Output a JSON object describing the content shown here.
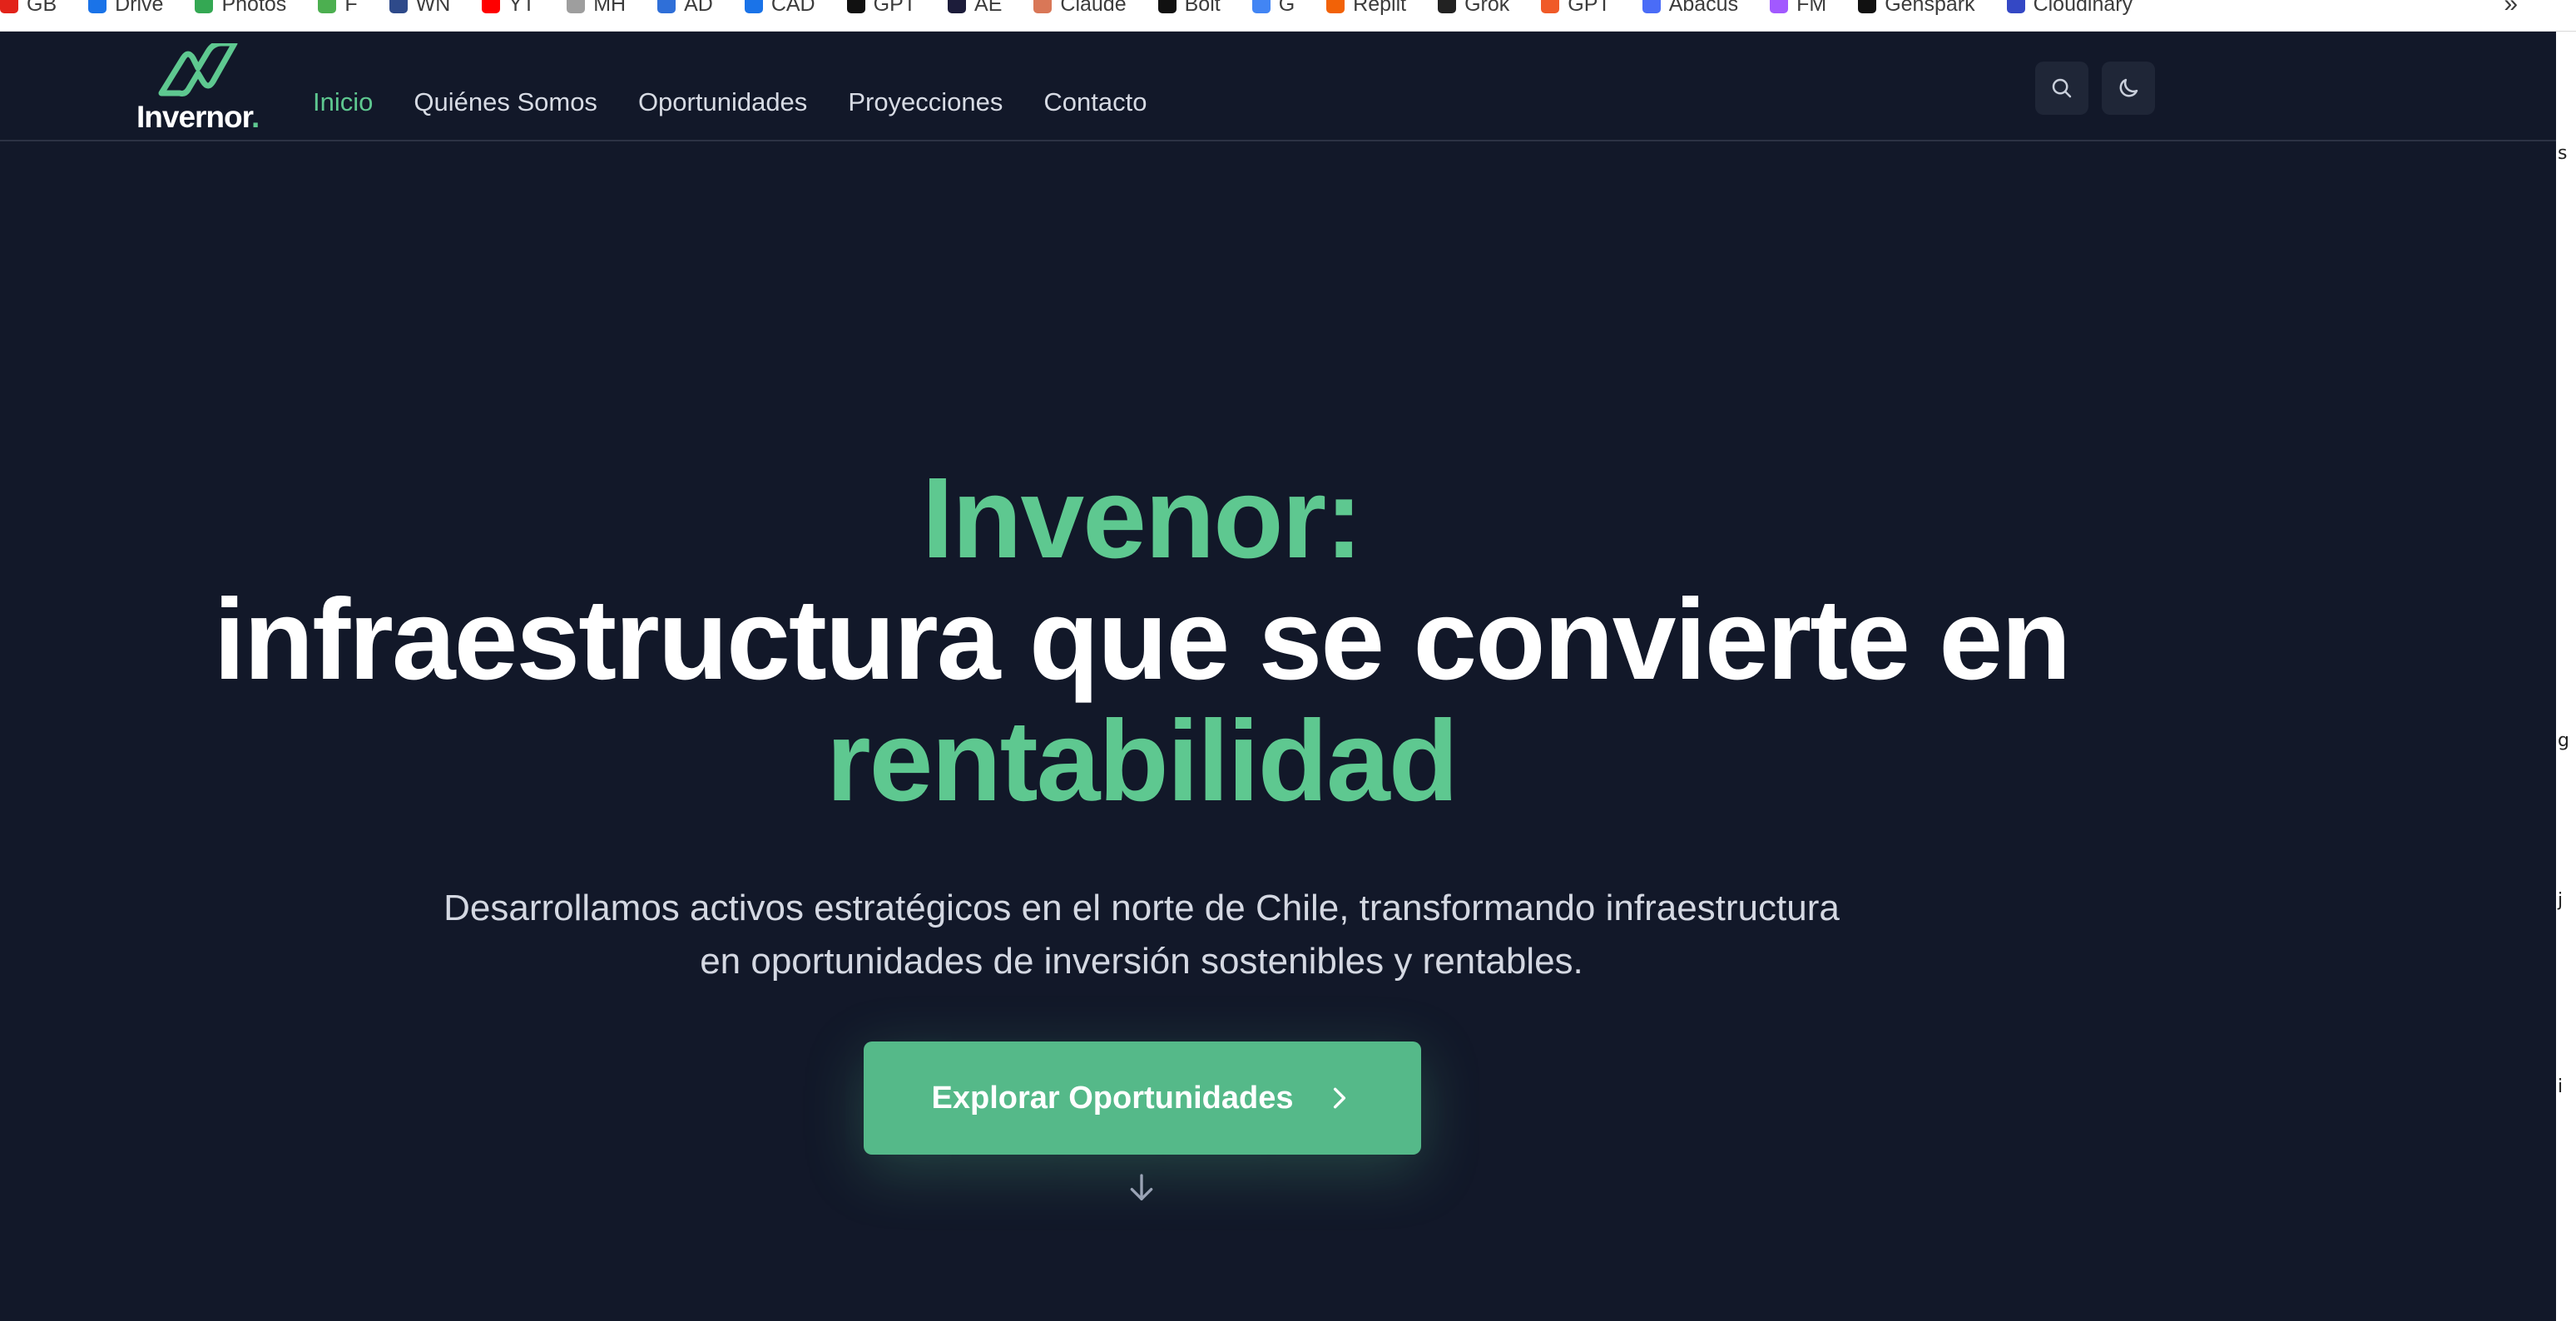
{
  "bookmarks": [
    {
      "label": "GB",
      "color": "#e2231a"
    },
    {
      "label": "Drive",
      "color": "#1a73e8"
    },
    {
      "label": "Photos",
      "color": "#34a853"
    },
    {
      "label": "F",
      "color": "#4caf50"
    },
    {
      "label": "WN",
      "color": "#2e4a8a"
    },
    {
      "label": "YT",
      "color": "#ff0000"
    },
    {
      "label": "MH",
      "color": "#9e9e9e"
    },
    {
      "label": "AD",
      "color": "#2f6fd8"
    },
    {
      "label": "CAD",
      "color": "#1a73e8"
    },
    {
      "label": "GPT",
      "color": "#111111"
    },
    {
      "label": "AE",
      "color": "#1c1c3a"
    },
    {
      "label": "Claude",
      "color": "#d97757"
    },
    {
      "label": "Bolt",
      "color": "#111111"
    },
    {
      "label": "G",
      "color": "#4285f4"
    },
    {
      "label": "Replit",
      "color": "#f26207"
    },
    {
      "label": "Grok",
      "color": "#222222"
    },
    {
      "label": "GPT",
      "color": "#f05a28"
    },
    {
      "label": "Abacus",
      "color": "#4a6cf7"
    },
    {
      "label": "FM",
      "color": "#a259ff"
    },
    {
      "label": "Genspark",
      "color": "#111111"
    },
    {
      "label": "Cloudinary",
      "color": "#3448c5"
    }
  ],
  "bookmarks_overflow": "»",
  "strip_chars": [
    "s",
    "g",
    "j",
    "i"
  ],
  "nav": {
    "logo_text": "Invernor",
    "logo_dot": ".",
    "links": [
      "Inicio",
      "Quiénes Somos",
      "Oportunidades",
      "Proyecciones",
      "Contacto"
    ],
    "active_index": 0
  },
  "hero": {
    "line1": "Invenor:",
    "line2": "infraestructura que se convierte en",
    "line3": "rentabilidad",
    "subtitle_line1": "Desarrollamos activos estratégicos en el norte de Chile, transformando infraestructura",
    "subtitle_line2": "en oportunidades de inversión sostenibles y rentables.",
    "cta_label": "Explorar Oportunidades"
  },
  "colors": {
    "background": "#121829",
    "accent": "#5ec890",
    "button": "#55b989",
    "text": "#ffffff",
    "muted": "#d4d8e2"
  },
  "icons": {
    "search": "search-icon",
    "theme": "moon-icon",
    "cta_arrow": "chevron-right-icon",
    "scroll": "arrow-down-icon"
  }
}
